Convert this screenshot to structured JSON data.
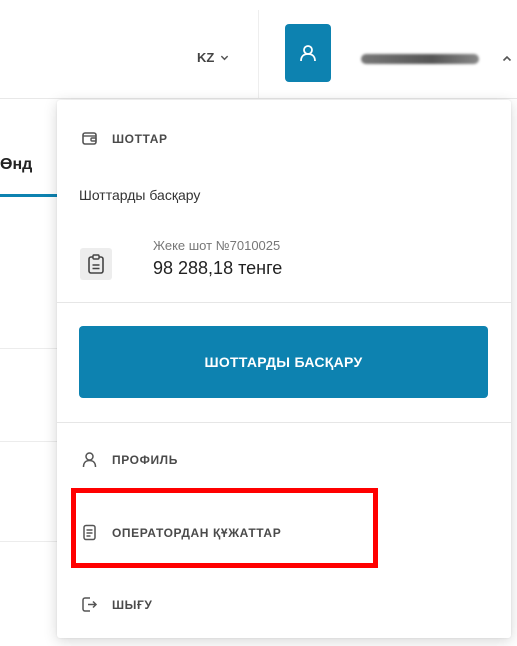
{
  "header": {
    "language": "KZ",
    "language_icon": "chevron-down-icon",
    "user_icon": "user-icon",
    "user_menu_icon": "chevron-up-icon"
  },
  "background": {
    "tab_label": "Өнд"
  },
  "dropdown": {
    "accounts_section": {
      "icon": "wallet-icon",
      "title": "ШОТТАР",
      "manage_link": "Шоттарды басқару",
      "account": {
        "icon": "document-icon",
        "label": "Жеке шот №7010025",
        "balance": "98 288,18 тенге"
      },
      "manage_button": "ШОТТАРДЫ БАСҚАРУ"
    },
    "menu": [
      {
        "icon": "user-icon",
        "label": "ПРОФИЛЬ"
      },
      {
        "icon": "document-icon",
        "label": "ОПЕРАТОРДАН ҚҰЖАТТАР"
      },
      {
        "icon": "logout-icon",
        "label": "ШЫҒУ"
      }
    ]
  },
  "colors": {
    "accent": "#0d82b0",
    "highlight": "#ff0000"
  }
}
